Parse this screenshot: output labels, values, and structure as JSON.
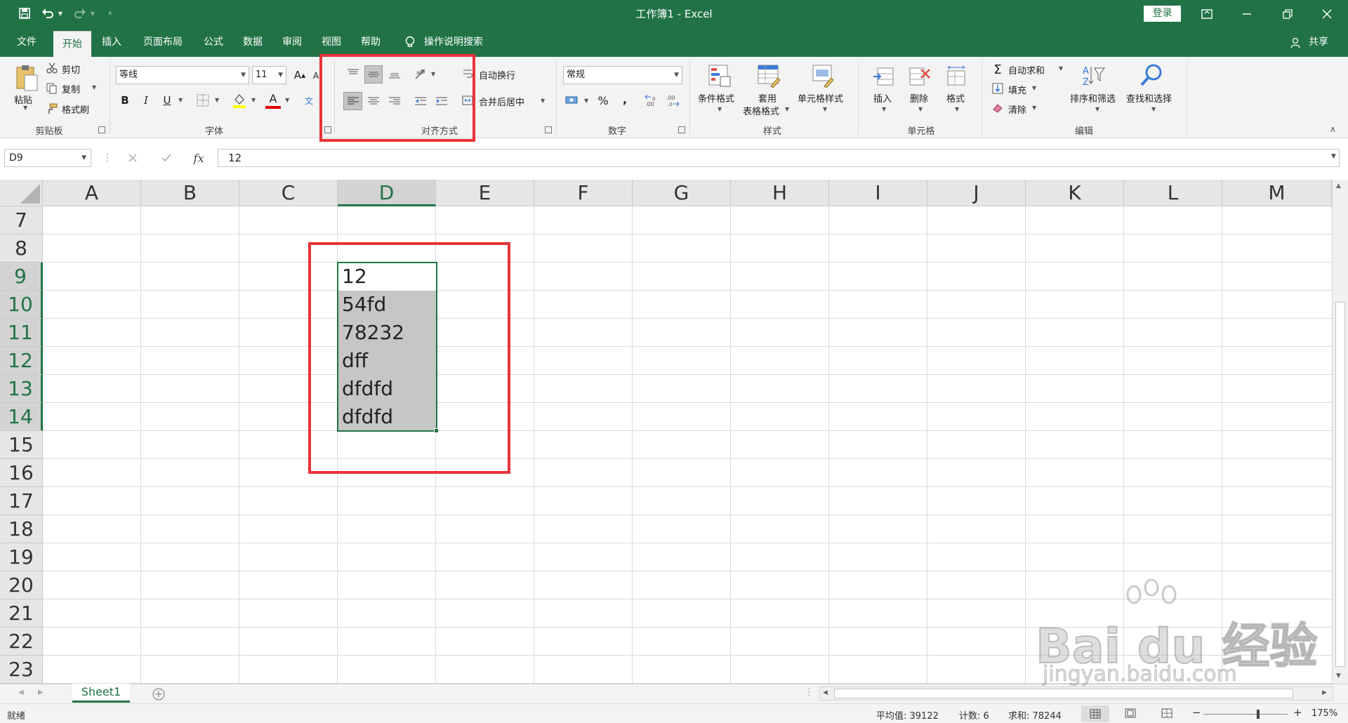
{
  "window": {
    "title": "工作簿1  -  Excel",
    "login_label": "登录"
  },
  "ribbon_tabs": [
    "文件",
    "开始",
    "插入",
    "页面布局",
    "公式",
    "数据",
    "审阅",
    "视图",
    "帮助"
  ],
  "tell_me": "操作说明搜索",
  "share_label": "共享",
  "clipboard": {
    "paste": "粘贴",
    "cut": "剪切",
    "copy": "复制",
    "format_painter": "格式刷",
    "group": "剪贴板"
  },
  "font": {
    "name": "等线",
    "size": "11",
    "group": "字体",
    "bold": "B",
    "italic": "I",
    "underline": "U",
    "font_color_letter": "A"
  },
  "alignment": {
    "wrap": "自动换行",
    "merge": "合并后居中",
    "group": "对齐方式"
  },
  "number": {
    "format": "常规",
    "percent": "%",
    "comma": ",",
    "group": "数字"
  },
  "styles": {
    "conditional": "条件格式",
    "table_line1": "套用",
    "table_line2": "表格格式",
    "cell_styles": "单元格样式",
    "group": "样式"
  },
  "cells": {
    "insert": "插入",
    "delete": "删除",
    "format": "格式",
    "group": "单元格"
  },
  "editing": {
    "autosum": "自动求和",
    "fill": "填充",
    "clear": "清除",
    "sort": "排序和筛选",
    "find": "查找和选择",
    "group": "编辑"
  },
  "formula_bar": {
    "name_box": "D9",
    "fx": "fx",
    "value": "12"
  },
  "columns": [
    "A",
    "B",
    "C",
    "D",
    "E",
    "F",
    "G",
    "H",
    "I",
    "J",
    "K",
    "L",
    "M"
  ],
  "rows": [
    "7",
    "8",
    "9",
    "10",
    "11",
    "12",
    "13",
    "14",
    "15",
    "16",
    "17",
    "18",
    "19",
    "20",
    "21",
    "22",
    "23"
  ],
  "cells_data": [
    "12",
    "54fd",
    "78232",
    "dff",
    "dfdfd",
    "dfdfd"
  ],
  "sheet_tab": "Sheet1",
  "status": {
    "ready": "就绪",
    "average": "平均值: 39122",
    "count": "计数: 6",
    "sum": "求和: 78244",
    "zoom": "175%"
  },
  "watermark": {
    "brand": "Bai du 经验",
    "url": "jingyan.baidu.com"
  },
  "colors": {
    "excel_green": "#217346",
    "annotation_red": "#e8333a",
    "selection_gray": "#c6c6c6"
  }
}
